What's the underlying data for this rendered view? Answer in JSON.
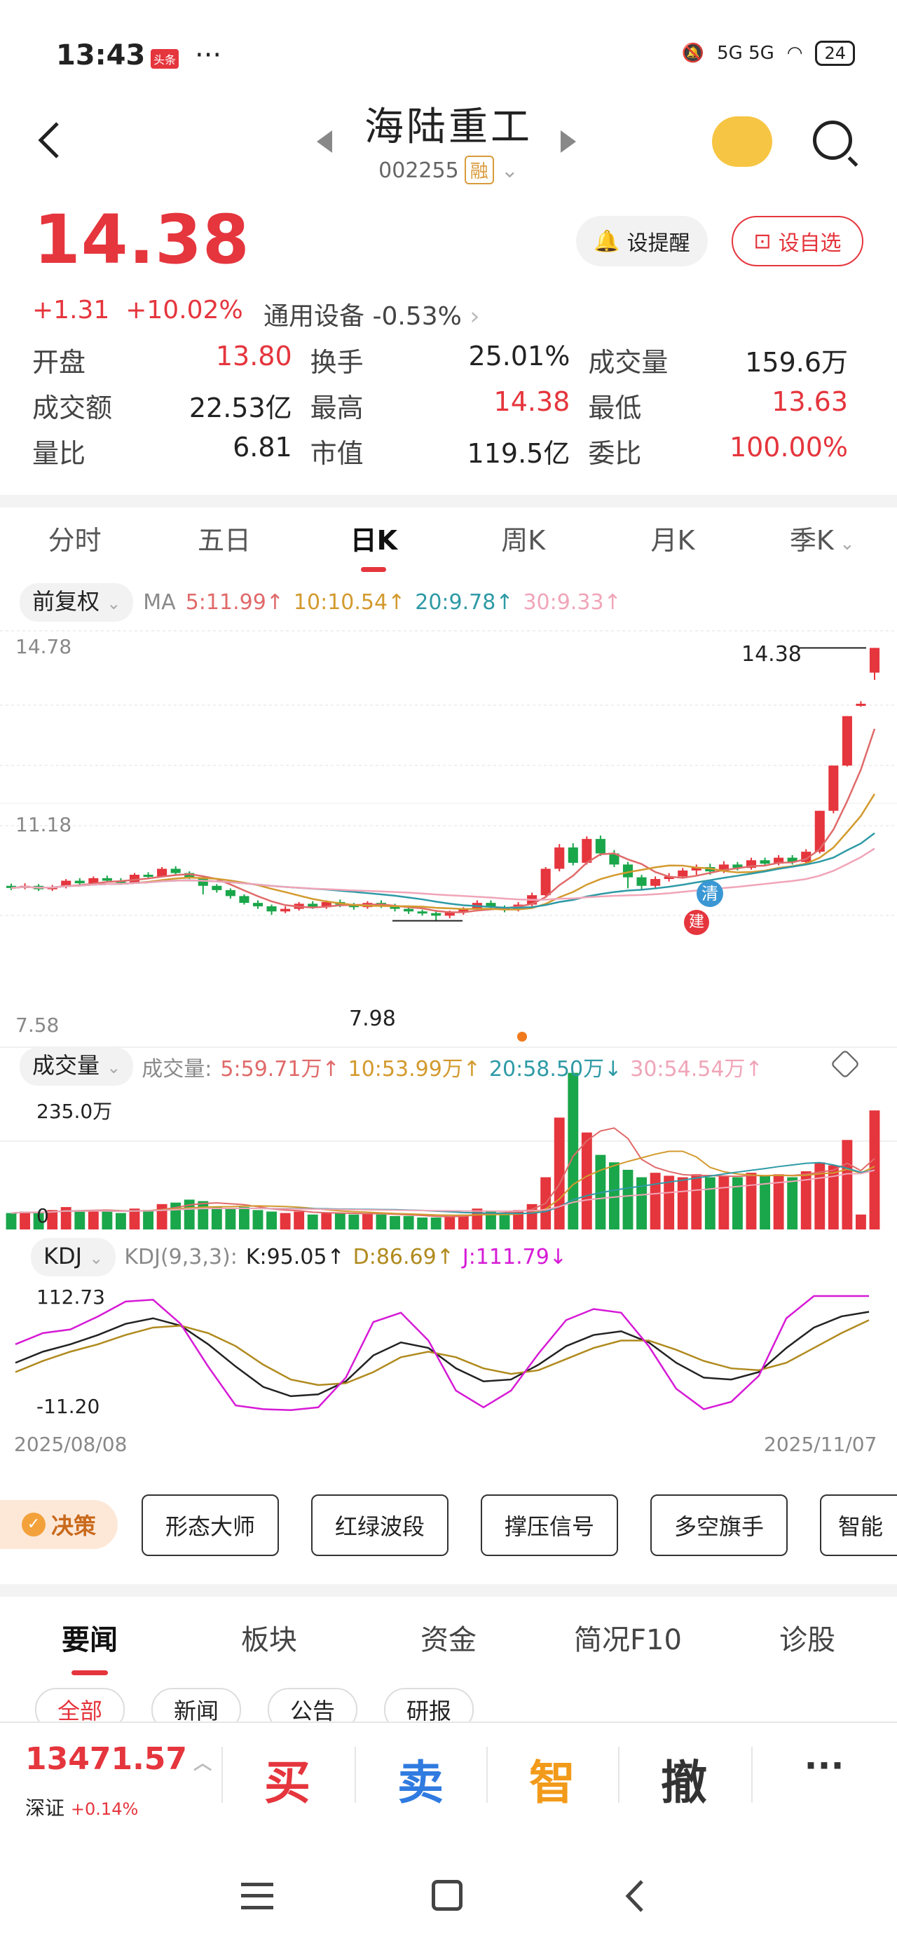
{
  "status_bar": {
    "time": "13:43",
    "app_badge": "头条",
    "dots": "···",
    "network": "5G 5G",
    "battery": "24"
  },
  "header": {
    "stock_name": "海陆重工",
    "stock_code": "002255",
    "margin_badge": "融"
  },
  "quote": {
    "price": "14.38",
    "change": "+1.31",
    "change_pct": "+10.02%",
    "sector_name": "通用设备",
    "sector_change": "-0.53%",
    "remind_label": "设提醒",
    "watchlist_label": "设自选"
  },
  "stats": [
    [
      {
        "label": "开盘",
        "value": "13.80",
        "color": "red"
      },
      {
        "label": "换手",
        "value": "25.01%",
        "color": "black"
      },
      {
        "label": "成交量",
        "value": "159.6万",
        "color": "black"
      }
    ],
    [
      {
        "label": "成交额",
        "value": "22.53亿",
        "color": "black"
      },
      {
        "label": "最高",
        "value": "14.38",
        "color": "red"
      },
      {
        "label": "最低",
        "value": "13.63",
        "color": "red"
      }
    ],
    [
      {
        "label": "量比",
        "value": "6.81",
        "color": "black"
      },
      {
        "label": "市值",
        "value": "119.5亿",
        "color": "black"
      },
      {
        "label": "委比",
        "value": "100.00%",
        "color": "red"
      }
    ]
  ],
  "kline_tabs": [
    "分时",
    "五日",
    "日K",
    "周K",
    "月K",
    "季K"
  ],
  "kline_active": "日K",
  "adjust_label": "前复权",
  "ma_legend": {
    "prefix": "MA",
    "ma5": "5:11.99↑",
    "ma10": "10:10.54↑",
    "ma20": "20:9.78↑",
    "ma30": "30:9.33↑"
  },
  "colors": {
    "up": "#e5353d",
    "down": "#1aa64a",
    "ma5": "#e06a6a",
    "ma10": "#d39a2e",
    "ma20": "#2e9aa6",
    "ma30": "#f0a5b8",
    "k": "#222222",
    "d": "#b08a1e",
    "j": "#d61ad6"
  },
  "price_axis": {
    "top": "14.78",
    "mid": "11.18",
    "bottom": "7.58",
    "high_tag": "14.38",
    "low_tag": "7.98"
  },
  "markers": {
    "qing": "清",
    "jian": "建"
  },
  "volume": {
    "chip": "成交量",
    "legend_prefix": "成交量:",
    "v5": "5:59.71万↑",
    "v10": "10:53.99万↑",
    "v20": "20:58.50万↓",
    "v30": "30:54.54万↑",
    "axis_top": "235.0万",
    "axis_zero": "0"
  },
  "kdj": {
    "chip": "KDJ",
    "params": "KDJ(9,3,3):",
    "k": "K:95.05↑",
    "d": "D:86.69↑",
    "j": "J:111.79↓",
    "axis_top": "112.73",
    "axis_bottom": "-11.20"
  },
  "dates": {
    "start": "2025/08/08",
    "end": "2025/11/07"
  },
  "tools": {
    "decision": "决策",
    "items": [
      "形态大师",
      "红绿波段",
      "撑压信号",
      "多空旗手",
      "智能"
    ]
  },
  "news_tabs": [
    "要闻",
    "板块",
    "资金",
    "简况F10",
    "诊股"
  ],
  "news_active": "要闻",
  "news_subtabs": [
    "全部",
    "新闻",
    "公告",
    "研报"
  ],
  "bottom": {
    "index_value": "13471.57",
    "index_name": "深证",
    "index_change": "+0.14%",
    "buy": "买",
    "sell": "卖",
    "smart": "智",
    "cancel": "撤",
    "more": "···"
  },
  "chart_data": {
    "type": "candlestick",
    "x_start": "2025/08/08",
    "x_end": "2025/11/07",
    "ylim": [
      7.58,
      14.78
    ],
    "candles": [
      [
        8.8,
        8.75,
        8.85,
        8.7
      ],
      [
        8.76,
        8.8,
        8.86,
        8.72
      ],
      [
        8.8,
        8.72,
        8.84,
        8.68
      ],
      [
        8.72,
        8.78,
        8.82,
        8.68
      ],
      [
        8.78,
        8.92,
        8.96,
        8.74
      ],
      [
        8.92,
        8.86,
        8.98,
        8.82
      ],
      [
        8.86,
        8.98,
        9.02,
        8.82
      ],
      [
        8.98,
        8.92,
        9.04,
        8.88
      ],
      [
        8.92,
        8.88,
        8.98,
        8.84
      ],
      [
        8.88,
        9.06,
        9.1,
        8.86
      ],
      [
        9.06,
        9.02,
        9.12,
        8.98
      ],
      [
        9.02,
        9.2,
        9.24,
        9.0
      ],
      [
        9.2,
        9.1,
        9.26,
        9.06
      ],
      [
        9.1,
        9.0,
        9.14,
        8.96
      ],
      [
        9.0,
        8.8,
        9.04,
        8.6
      ],
      [
        8.8,
        8.7,
        8.84,
        8.64
      ],
      [
        8.7,
        8.56,
        8.74,
        8.5
      ],
      [
        8.56,
        8.4,
        8.6,
        8.36
      ],
      [
        8.4,
        8.32,
        8.46,
        8.26
      ],
      [
        8.32,
        8.2,
        8.36,
        8.12
      ],
      [
        8.2,
        8.26,
        8.32,
        8.16
      ],
      [
        8.26,
        8.38,
        8.42,
        8.22
      ],
      [
        8.38,
        8.3,
        8.44,
        8.26
      ],
      [
        8.3,
        8.42,
        8.46,
        8.26
      ],
      [
        8.42,
        8.36,
        8.48,
        8.3
      ],
      [
        8.36,
        8.3,
        8.4,
        8.24
      ],
      [
        8.3,
        8.4,
        8.44,
        8.26
      ],
      [
        8.4,
        8.34,
        8.46,
        8.28
      ],
      [
        8.34,
        8.26,
        8.38,
        8.2
      ],
      [
        8.26,
        8.2,
        8.3,
        8.14
      ],
      [
        8.2,
        8.16,
        8.24,
        8.1
      ],
      [
        8.16,
        8.1,
        8.2,
        7.98
      ],
      [
        8.1,
        8.18,
        8.22,
        8.04
      ],
      [
        8.18,
        8.26,
        8.3,
        8.12
      ],
      [
        8.26,
        8.4,
        8.46,
        8.22
      ],
      [
        8.4,
        8.3,
        8.46,
        8.24
      ],
      [
        8.3,
        8.24,
        8.34,
        8.18
      ],
      [
        8.24,
        8.36,
        8.42,
        8.2
      ],
      [
        8.36,
        8.58,
        8.64,
        8.32
      ],
      [
        8.58,
        9.2,
        9.24,
        8.54
      ],
      [
        9.2,
        9.7,
        9.78,
        9.14
      ],
      [
        9.7,
        9.34,
        9.8,
        9.28
      ],
      [
        9.34,
        9.9,
        9.96,
        9.3
      ],
      [
        9.9,
        9.56,
        9.98,
        9.5
      ],
      [
        9.56,
        9.3,
        9.64,
        9.24
      ],
      [
        9.3,
        9.0,
        9.36,
        8.74
      ],
      [
        9.0,
        8.8,
        9.06,
        8.72
      ],
      [
        8.8,
        8.96,
        9.02,
        8.76
      ],
      [
        8.96,
        9.02,
        9.1,
        8.9
      ],
      [
        9.02,
        9.16,
        9.22,
        8.98
      ],
      [
        9.16,
        9.24,
        9.3,
        9.04
      ],
      [
        9.24,
        9.14,
        9.32,
        9.06
      ],
      [
        9.14,
        9.3,
        9.38,
        9.1
      ],
      [
        9.3,
        9.22,
        9.36,
        9.16
      ],
      [
        9.22,
        9.4,
        9.46,
        9.18
      ],
      [
        9.4,
        9.32,
        9.46,
        9.26
      ],
      [
        9.32,
        9.46,
        9.52,
        9.28
      ],
      [
        9.46,
        9.36,
        9.52,
        9.3
      ],
      [
        9.36,
        9.6,
        9.66,
        9.32
      ],
      [
        9.6,
        10.56,
        10.56,
        9.56
      ],
      [
        10.56,
        11.62,
        11.62,
        10.5
      ],
      [
        11.62,
        12.78,
        12.78,
        11.6
      ],
      [
        13.07,
        13.07,
        13.13,
        13.0
      ],
      [
        13.8,
        14.38,
        14.38,
        13.63
      ]
    ],
    "ma_series": [
      {
        "name": "MA5",
        "last": 11.99
      },
      {
        "name": "MA10",
        "last": 10.54
      },
      {
        "name": "MA20",
        "last": 9.78
      },
      {
        "name": "MA30",
        "last": 9.33
      }
    ],
    "volume_ylim": [
      0,
      235.0
    ],
    "volume_unit": "万",
    "volume": [
      22,
      24,
      22,
      26,
      30,
      24,
      26,
      24,
      22,
      28,
      26,
      34,
      36,
      40,
      38,
      30,
      28,
      30,
      26,
      24,
      22,
      24,
      20,
      22,
      22,
      20,
      22,
      20,
      18,
      18,
      16,
      16,
      18,
      20,
      28,
      24,
      22,
      26,
      34,
      70,
      150,
      210,
      130,
      100,
      90,
      80,
      70,
      76,
      72,
      70,
      74,
      70,
      72,
      70,
      76,
      72,
      74,
      70,
      78,
      90,
      86,
      120,
      20,
      159.6
    ],
    "kdj_ylim": [
      -11.2,
      112.73
    ],
    "kdj": {
      "K": [
        40,
        52,
        60,
        70,
        82,
        88,
        80,
        60,
        36,
        14,
        4,
        6,
        20,
        48,
        62,
        56,
        34,
        20,
        22,
        38,
        58,
        70,
        74,
        62,
        40,
        24,
        22,
        30,
        56,
        78,
        90,
        95
      ],
      "D": [
        30,
        42,
        52,
        60,
        70,
        78,
        80,
        72,
        58,
        38,
        22,
        16,
        18,
        30,
        46,
        52,
        46,
        34,
        28,
        32,
        44,
        56,
        64,
        64,
        54,
        42,
        34,
        32,
        40,
        56,
        72,
        86
      ],
      "J": [
        60,
        72,
        76,
        90,
        106,
        108,
        82,
        36,
        -6,
        -10,
        -11,
        -8,
        24,
        84,
        94,
        64,
        10,
        -8,
        10,
        50,
        86,
        98,
        94,
        58,
        12,
        -10,
        -2,
        26,
        88,
        112,
        112,
        112
      ]
    }
  }
}
